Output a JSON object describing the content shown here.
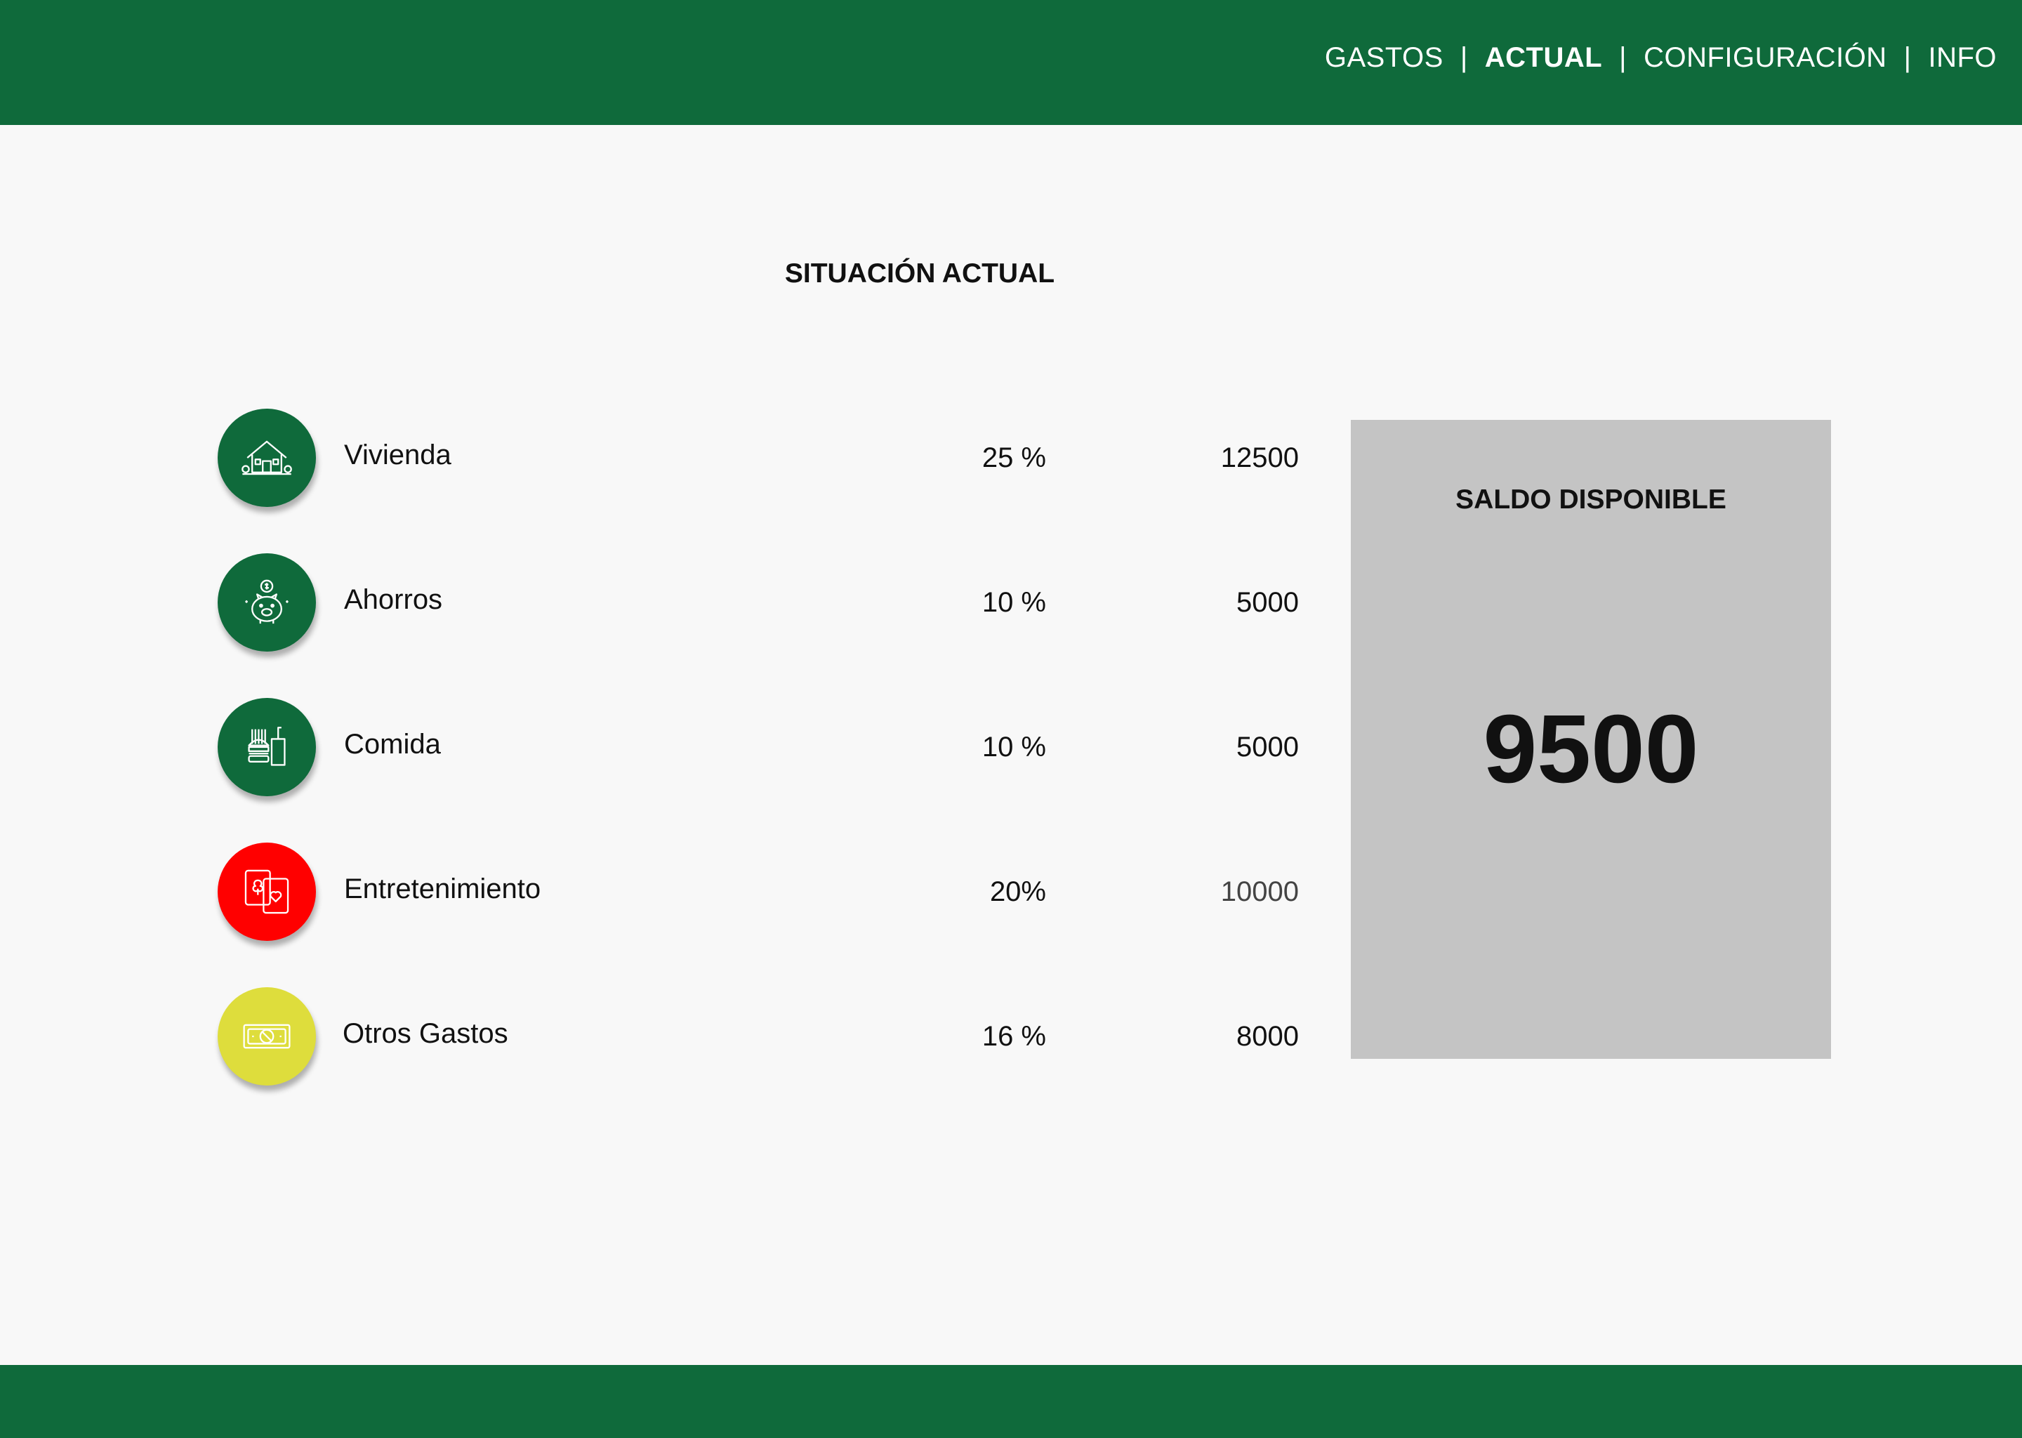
{
  "nav": {
    "items": [
      {
        "label": "GASTOS",
        "active": false
      },
      {
        "label": "ACTUAL",
        "active": true
      },
      {
        "label": "CONFIGURACIÓN",
        "active": false
      },
      {
        "label": "INFO",
        "active": false
      }
    ],
    "separator": "|"
  },
  "page": {
    "title": "SITUACIÓN ACTUAL"
  },
  "categories": [
    {
      "name": "Vivienda",
      "percent": "25 %",
      "amount": "12500",
      "icon": "house-icon",
      "color": "#0f6a3b"
    },
    {
      "name": "Ahorros",
      "percent": "10 %",
      "amount": "5000",
      "icon": "piggy-bank-icon",
      "color": "#0f6a3b"
    },
    {
      "name": "Comida",
      "percent": "10 %",
      "amount": "5000",
      "icon": "food-icon",
      "color": "#0f6a3b"
    },
    {
      "name": "Entretenimiento",
      "percent": "20%",
      "amount": "10000",
      "icon": "playing-cards-icon",
      "color": "#ff0000"
    },
    {
      "name": "Otros Gastos",
      "percent": "16 %",
      "amount": "8000",
      "icon": "money-bill-icon",
      "color": "#dedd3c"
    }
  ],
  "saldo": {
    "title": "SALDO DISPONIBLE",
    "value": "9500"
  },
  "colors": {
    "brand_green": "#0f6a3b",
    "alert_red": "#ff0000",
    "warning_yellow": "#dedd3c",
    "panel_gray": "#c4c4c4"
  }
}
